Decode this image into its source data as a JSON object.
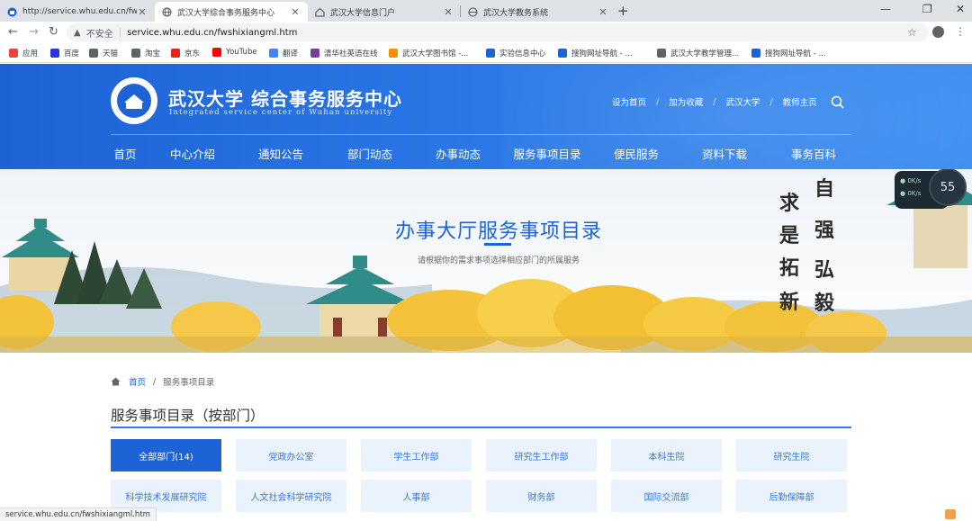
{
  "browser": {
    "tabs": [
      {
        "title": "http://service.whu.edu.cn/fwsh",
        "active": false,
        "icon": "university-favicon"
      },
      {
        "title": "武汉大学综合事务服务中心",
        "active": true,
        "icon": "globe-favicon"
      },
      {
        "title": "武汉大学信息门户",
        "active": false,
        "icon": "home-favicon"
      },
      {
        "title": "武汉大学教务系统",
        "active": false,
        "icon": "page-favicon"
      }
    ],
    "address": {
      "security_label": "不安全",
      "url": "service.whu.edu.cn/fwshixiangml.htm"
    },
    "bookmarks": [
      {
        "label": "应用",
        "icon": "apps-grid-icon",
        "color": "#e8453c"
      },
      {
        "label": "百度",
        "icon": "baidu-icon",
        "color": "#2932e1"
      },
      {
        "label": "天猫",
        "icon": "globe-icon",
        "color": "#5f6368"
      },
      {
        "label": "淘宝",
        "icon": "globe-icon",
        "color": "#5f6368"
      },
      {
        "label": "京东",
        "icon": "jd-icon",
        "color": "#e1251b"
      },
      {
        "label": "YouTube",
        "icon": "youtube-icon",
        "color": "#ff0000"
      },
      {
        "label": "翻译",
        "icon": "translate-icon",
        "color": "#4285f4"
      },
      {
        "label": "清华社英语在线",
        "icon": "book-icon",
        "color": "#7a3e9d"
      },
      {
        "label": "武汉大学图书馆 -...",
        "icon": "library-icon",
        "color": "#f29100"
      },
      {
        "label": "实验信息中心",
        "icon": "lab-icon",
        "color": "#1d63d6"
      },
      {
        "label": "搜狗网址导航 - ...",
        "icon": "sogou-icon",
        "color": "#1d63d6"
      },
      {
        "label": "武汉大学教学管理...",
        "icon": "globe-icon",
        "color": "#5f6368"
      },
      {
        "label": "搜狗网址导航 - ...",
        "icon": "sogou-icon",
        "color": "#1d63d6"
      }
    ],
    "status_text": "service.whu.edu.cn/fwshixiangml.htm"
  },
  "site": {
    "logo_title": "武汉大学 综合事务服务中心",
    "logo_subtitle": "Integrated service center of Wuhan university",
    "top_links": [
      "设为首页",
      "加为收藏",
      "武汉大学",
      "教师主页"
    ],
    "nav": [
      "首页",
      "中心介绍",
      "通知公告",
      "部门动态",
      "办事动态",
      "服务事项目录",
      "便民服务",
      "资料下载",
      "事务百科"
    ],
    "colors": {
      "brand_blue": "#1d63d6",
      "chip_bg": "#e9f2fd",
      "chip_text": "#3a7bd5"
    }
  },
  "banner": {
    "title": "办事大厅服务事项目录",
    "subtitle": "请根据你的需求事项选择相应部门的所属服务",
    "motto": [
      "自",
      "强",
      "弘",
      "毅",
      "求",
      "是",
      "拓",
      "新"
    ],
    "speed_widget": {
      "percent": "55",
      "upload": "0K/s",
      "download": "0K/s"
    }
  },
  "content": {
    "breadcrumb": {
      "home": "首页",
      "current": "服务事项目录"
    },
    "section_title": "服务事项目录（按部门）",
    "departments": [
      {
        "label": "全部部门(14)",
        "active": true
      },
      {
        "label": "党政办公室",
        "active": false
      },
      {
        "label": "学生工作部",
        "active": false
      },
      {
        "label": "研究生工作部",
        "active": false
      },
      {
        "label": "本科生院",
        "active": false
      },
      {
        "label": "研究生院",
        "active": false
      },
      {
        "label": "科学技术发展研究院",
        "active": false
      },
      {
        "label": "人文社会科学研究院",
        "active": false
      },
      {
        "label": "人事部",
        "active": false
      },
      {
        "label": "财务部",
        "active": false
      },
      {
        "label": "国际交流部",
        "active": false
      },
      {
        "label": "后勤保障部",
        "active": false
      }
    ]
  }
}
